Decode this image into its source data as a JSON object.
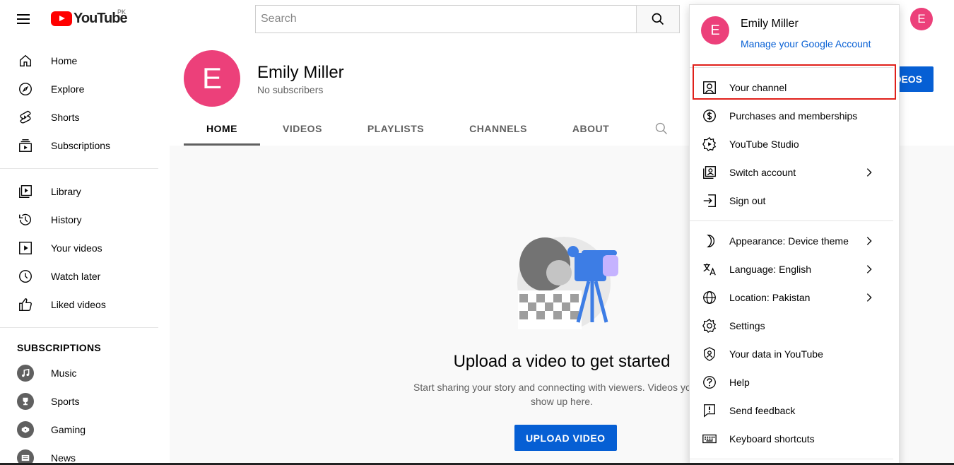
{
  "colors": {
    "brand_red": "#ff0000",
    "avatar_pink": "#ec407a",
    "accent_blue": "#065fd4",
    "highlight_red": "#e0201a"
  },
  "masthead": {
    "logo_text": "YouTube",
    "country_code": "PK",
    "search_placeholder": "Search",
    "avatar_letter": "E"
  },
  "sidebar": {
    "main_items": [
      {
        "label": "Home",
        "icon": "home-icon"
      },
      {
        "label": "Explore",
        "icon": "compass-icon"
      },
      {
        "label": "Shorts",
        "icon": "shorts-icon"
      },
      {
        "label": "Subscriptions",
        "icon": "subscriptions-icon"
      }
    ],
    "library_items": [
      {
        "label": "Library",
        "icon": "library-icon"
      },
      {
        "label": "History",
        "icon": "history-icon"
      },
      {
        "label": "Your videos",
        "icon": "your-videos-icon"
      },
      {
        "label": "Watch later",
        "icon": "clock-icon"
      },
      {
        "label": "Liked videos",
        "icon": "thumbs-up-icon"
      }
    ],
    "subscriptions_heading": "SUBSCRIPTIONS",
    "subscriptions": [
      {
        "label": "Music",
        "icon": "music-icon"
      },
      {
        "label": "Sports",
        "icon": "trophy-icon"
      },
      {
        "label": "Gaming",
        "icon": "gamepad-icon"
      },
      {
        "label": "News",
        "icon": "news-icon"
      }
    ]
  },
  "channel": {
    "avatar_letter": "E",
    "name": "Emily Miller",
    "subscribers": "No subscribers",
    "manage_videos_label": "MANAGE VIDEOS",
    "tabs": [
      "HOME",
      "VIDEOS",
      "PLAYLISTS",
      "CHANNELS",
      "ABOUT"
    ],
    "active_tab": "HOME"
  },
  "empty_state": {
    "title": "Upload a video to get started",
    "description_line1": "Start sharing your story and connecting with viewers. Videos you up",
    "description_line2": "show up here.",
    "button_label": "UPLOAD VIDEO"
  },
  "menu": {
    "avatar_letter": "E",
    "user_name": "Emily Miller",
    "manage_account": "Manage your Google Account",
    "group1": [
      {
        "label": "Your channel",
        "icon": "person-box-icon",
        "chevron": false
      },
      {
        "label": "Purchases and memberships",
        "icon": "dollar-icon",
        "chevron": false
      },
      {
        "label": "YouTube Studio",
        "icon": "studio-gear-icon",
        "chevron": false
      },
      {
        "label": "Switch account",
        "icon": "switch-account-icon",
        "chevron": true
      },
      {
        "label": "Sign out",
        "icon": "sign-out-icon",
        "chevron": false
      }
    ],
    "group2": [
      {
        "label": "Appearance: Device theme",
        "icon": "moon-icon",
        "chevron": true
      },
      {
        "label": "Language: English",
        "icon": "translate-icon",
        "chevron": true
      },
      {
        "label": "Location: Pakistan",
        "icon": "globe-icon",
        "chevron": true
      },
      {
        "label": "Settings",
        "icon": "settings-icon",
        "chevron": false
      },
      {
        "label": "Your data in YouTube",
        "icon": "shield-person-icon",
        "chevron": false
      },
      {
        "label": "Help",
        "icon": "help-icon",
        "chevron": false
      },
      {
        "label": "Send feedback",
        "icon": "feedback-icon",
        "chevron": false
      },
      {
        "label": "Keyboard shortcuts",
        "icon": "keyboard-icon",
        "chevron": false
      }
    ]
  }
}
